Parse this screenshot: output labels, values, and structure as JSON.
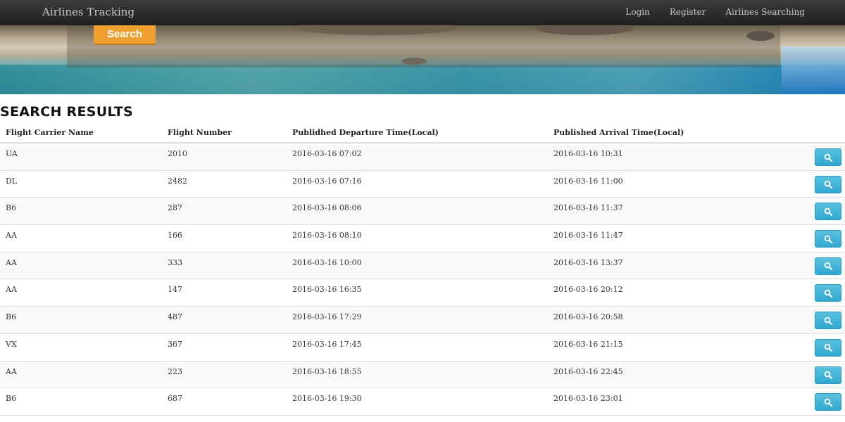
{
  "navbar": {
    "brand": "Airlines Tracking",
    "links": [
      "Login",
      "Register",
      "Airlines Searching"
    ]
  },
  "hero": {
    "search_label": "Search"
  },
  "results": {
    "title": "SEARCH RESULTS",
    "columns": [
      "Flight Carrier Name",
      "Flight Number",
      "Publidhed Departure Time(Local)",
      "Published Arrival Time(Local)"
    ],
    "rows": [
      {
        "carrier": "UA",
        "number": "2010",
        "departure": "2016-03-16 07:02",
        "arrival": "2016-03-16 10:31"
      },
      {
        "carrier": "DL",
        "number": "2482",
        "departure": "2016-03-16 07:16",
        "arrival": "2016-03-16 11:00"
      },
      {
        "carrier": "B6",
        "number": "287",
        "departure": "2016-03-16 08:06",
        "arrival": "2016-03-16 11:37"
      },
      {
        "carrier": "AA",
        "number": "166",
        "departure": "2016-03-16 08:10",
        "arrival": "2016-03-16 11:47"
      },
      {
        "carrier": "AA",
        "number": "333",
        "departure": "2016-03-16 10:00",
        "arrival": "2016-03-16 13:37"
      },
      {
        "carrier": "AA",
        "number": "147",
        "departure": "2016-03-16 16:35",
        "arrival": "2016-03-16 20:12"
      },
      {
        "carrier": "B6",
        "number": "487",
        "departure": "2016-03-16 17:29",
        "arrival": "2016-03-16 20:58"
      },
      {
        "carrier": "VX",
        "number": "367",
        "departure": "2016-03-16 17:45",
        "arrival": "2016-03-16 21:15"
      },
      {
        "carrier": "AA",
        "number": "223",
        "departure": "2016-03-16 18:55",
        "arrival": "2016-03-16 22:45"
      },
      {
        "carrier": "B6",
        "number": "687",
        "departure": "2016-03-16 19:30",
        "arrival": "2016-03-16 23:01"
      }
    ],
    "row_action_icon": "search-icon"
  },
  "colors": {
    "navbar": "#2b2b2b",
    "search_button": "#f0a030",
    "row_button": "#39b3d7"
  }
}
